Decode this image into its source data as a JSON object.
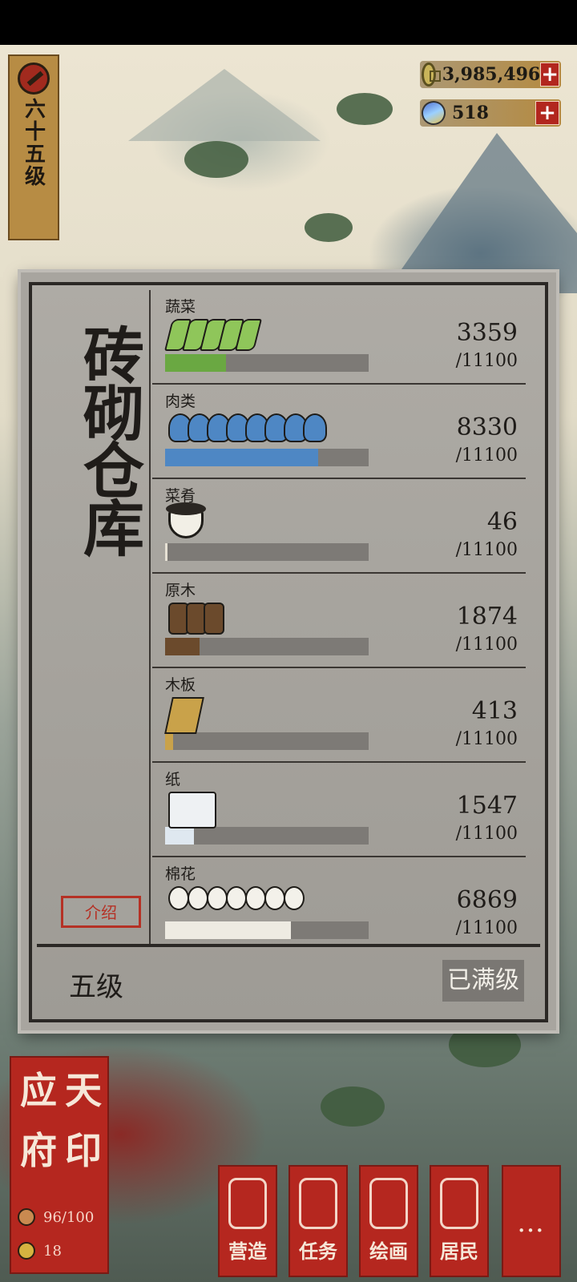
{
  "level_badge": {
    "text": "六十五级"
  },
  "resources": [
    {
      "name": "coins",
      "value": "3,985,496",
      "plus": "+"
    },
    {
      "name": "jade",
      "value": "518",
      "plus": "+"
    }
  ],
  "warehouse": {
    "title": "砖砌仓库",
    "intro_label": "介绍",
    "level_label": "五级",
    "max_label": "已满级",
    "items": [
      {
        "name": "蔬菜",
        "count": "3359",
        "capacity": "/11100",
        "fill_fraction": 0.3,
        "color": "#6aa842",
        "icon": "vegetable-icon"
      },
      {
        "name": "肉类",
        "count": "8330",
        "capacity": "/11100",
        "fill_fraction": 0.75,
        "color": "#4e87c4",
        "icon": "meat-icon"
      },
      {
        "name": "菜肴",
        "count": "46",
        "capacity": "/11100",
        "fill_fraction": 0.01,
        "color": "#e6e1d4",
        "icon": "dish-icon"
      },
      {
        "name": "原木",
        "count": "1874",
        "capacity": "/11100",
        "fill_fraction": 0.17,
        "color": "#6b4a2c",
        "icon": "log-icon"
      },
      {
        "name": "木板",
        "count": "413",
        "capacity": "/11100",
        "fill_fraction": 0.04,
        "color": "#c9a24a",
        "icon": "plank-icon"
      },
      {
        "name": "纸",
        "count": "1547",
        "capacity": "/11100",
        "fill_fraction": 0.14,
        "color": "#dfe8f0",
        "icon": "paper-icon"
      },
      {
        "name": "棉花",
        "count": "6869",
        "capacity": "/11100",
        "fill_fraction": 0.62,
        "color": "#eeebe2",
        "icon": "cotton-icon"
      }
    ]
  },
  "seal": {
    "chars": [
      "应",
      "天",
      "府",
      "印"
    ],
    "population": "96/100",
    "coins": "18"
  },
  "bottom_menu": [
    {
      "label": "营造",
      "icon": "build-icon"
    },
    {
      "label": "任务",
      "icon": "task-icon"
    },
    {
      "label": "绘画",
      "icon": "painting-icon"
    },
    {
      "label": "居民",
      "icon": "residents-icon"
    },
    {
      "label": "…",
      "icon": "more-icon"
    }
  ]
}
